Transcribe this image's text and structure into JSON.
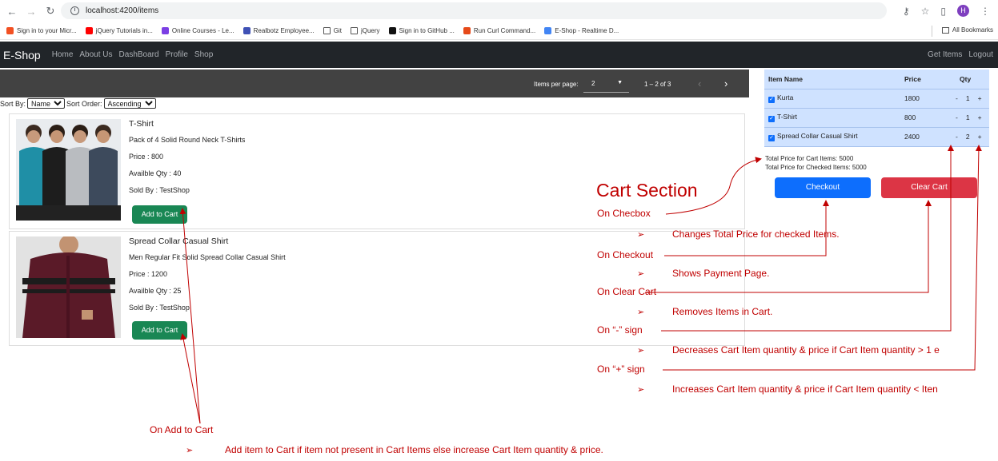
{
  "browser": {
    "url": "localhost:4200/items",
    "avatar_letter": "H",
    "bookmarks": [
      {
        "label": "Sign in to your Micr...",
        "color": "#f25022"
      },
      {
        "label": "jQuery Tutorials in...",
        "color": "#ff0000"
      },
      {
        "label": "Online Courses - Le...",
        "color": "#7b3fe4"
      },
      {
        "label": "Realbotz Employee...",
        "color": "#3f51b5"
      },
      {
        "label": "Git",
        "color": "folder"
      },
      {
        "label": "jQuery",
        "color": "folder"
      },
      {
        "label": "Sign in to GitHub ...",
        "color": "#111111"
      },
      {
        "label": "Run Curl Command...",
        "color": "#e64a19"
      },
      {
        "label": "E-Shop - Realtime D...",
        "color": "#4285f4"
      }
    ],
    "all_bookmarks": "All Bookmarks"
  },
  "navbar": {
    "brand": "E-Shop",
    "links": [
      "Home",
      "About Us",
      "DashBoard",
      "Profile",
      "Shop"
    ],
    "right": [
      "Get Items",
      "Logout"
    ]
  },
  "paginator": {
    "items_per_page_label": "Items per page:",
    "items_per_page": "2",
    "range": "1 – 2 of 3"
  },
  "sort": {
    "sort_by_label": "Sort By:",
    "sort_by": "Name",
    "sort_order_label": "Sort Order:",
    "sort_order": "Ascending"
  },
  "products": [
    {
      "name": "T-Shirt",
      "description": "Pack of 4 Solid Round Neck T-Shirts",
      "price": "Price : 800",
      "qty": "Availble Qty : 40",
      "seller": "Sold By : TestShop",
      "button": "Add to Cart"
    },
    {
      "name": "Spread Collar Casual Shirt",
      "description": "Men Regular Fit Solid Spread Collar Casual Shirt",
      "price": "Price : 1200",
      "qty": "Availble Qty : 25",
      "seller": "Sold By : TestShop",
      "button": "Add to Cart"
    }
  ],
  "cart": {
    "headers": [
      "Item Name",
      "Price",
      "Qty"
    ],
    "items": [
      {
        "name": "Kurta",
        "price": "1800",
        "qty": "1"
      },
      {
        "name": "T-Shirt",
        "price": "800",
        "qty": "1"
      },
      {
        "name": "Spread Collar Casual Shirt",
        "price": "2400",
        "qty": "2"
      }
    ],
    "minus": "-",
    "plus": "+",
    "total_cart": "Total Price for Cart Items: 5000",
    "total_checked": "Total Price for Checked Items: 5000",
    "checkout": "Checkout",
    "clear": "Clear Cart"
  },
  "annotations": {
    "title": "Cart Section",
    "on_checkbox": "On Checbox",
    "checkbox_desc": "Changes Total Price for checked Items.",
    "on_checkout": "On Checkout",
    "checkout_desc": "Shows Payment Page.",
    "on_clear": "On Clear Cart",
    "clear_desc": "Removes Items in Cart.",
    "on_minus": "On “-” sign",
    "minus_desc": "Decreases Cart Item quantity & price if Cart Item quantity > 1 e",
    "on_plus": "On “+” sign",
    "plus_desc": "Increases Cart Item quantity & price if Cart Item quantity < Iten",
    "on_add": "On Add to Cart",
    "add_desc": "Add item to Cart if item not present in Cart Items else increase Cart Item quantity & price.",
    "bullet": "➢",
    "color": "#c00000"
  }
}
